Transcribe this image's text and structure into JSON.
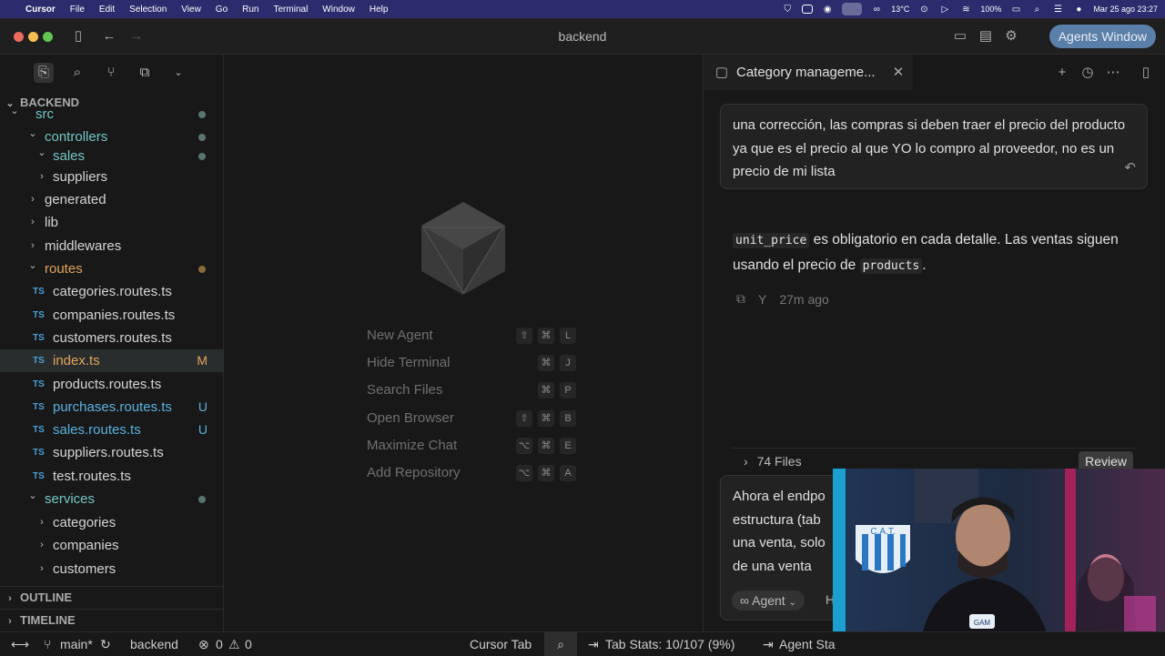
{
  "menubar": {
    "app_name": "Cursor",
    "items": [
      "File",
      "Edit",
      "Selection",
      "View",
      "Go",
      "Run",
      "Terminal",
      "Window",
      "Help"
    ],
    "temperature": "13°C",
    "battery": "100%",
    "datetime": "Mar 25 ago  23:27"
  },
  "window": {
    "title": "backend",
    "agents_button": "Agents Window"
  },
  "sidebar": {
    "explorer_title": "BACKEND",
    "tree": [
      {
        "label": "src",
        "depth": 0,
        "kind": "folder-open",
        "color": "mod",
        "dot": true
      },
      {
        "label": "controllers",
        "depth": 1,
        "kind": "folder-open",
        "color": "mod",
        "dot": true
      },
      {
        "label": "sales",
        "depth": 2,
        "kind": "folder-open",
        "color": "mod",
        "dot": true
      },
      {
        "label": "suppliers",
        "depth": 2,
        "kind": "folder",
        "color": "default"
      },
      {
        "label": "generated",
        "depth": 1,
        "kind": "folder",
        "color": "default"
      },
      {
        "label": "lib",
        "depth": 1,
        "kind": "folder",
        "color": "default"
      },
      {
        "label": "middlewares",
        "depth": 1,
        "kind": "folder",
        "color": "default"
      },
      {
        "label": "routes",
        "depth": 1,
        "kind": "folder-open",
        "color": "orange",
        "dot": true,
        "dot_color": "#8a6a3a"
      },
      {
        "label": "categories.routes.ts",
        "depth": 2,
        "kind": "ts",
        "color": "default"
      },
      {
        "label": "companies.routes.ts",
        "depth": 2,
        "kind": "ts",
        "color": "default"
      },
      {
        "label": "customers.routes.ts",
        "depth": 2,
        "kind": "ts",
        "color": "default"
      },
      {
        "label": "index.ts",
        "depth": 2,
        "kind": "ts",
        "color": "orange",
        "badge": "M",
        "selected": true
      },
      {
        "label": "products.routes.ts",
        "depth": 2,
        "kind": "ts",
        "color": "default"
      },
      {
        "label": "purchases.routes.ts",
        "depth": 2,
        "kind": "ts",
        "color": "untr",
        "badge": "U"
      },
      {
        "label": "sales.routes.ts",
        "depth": 2,
        "kind": "ts",
        "color": "untr",
        "badge": "U"
      },
      {
        "label": "suppliers.routes.ts",
        "depth": 2,
        "kind": "ts",
        "color": "default"
      },
      {
        "label": "test.routes.ts",
        "depth": 2,
        "kind": "ts",
        "color": "default"
      },
      {
        "label": "services",
        "depth": 1,
        "kind": "folder-open",
        "color": "mod",
        "dot": true
      },
      {
        "label": "categories",
        "depth": 2,
        "kind": "folder",
        "color": "default"
      },
      {
        "label": "companies",
        "depth": 2,
        "kind": "folder",
        "color": "default"
      },
      {
        "label": "customers",
        "depth": 2,
        "kind": "folder",
        "color": "default"
      }
    ],
    "outline": "OUTLINE",
    "timeline": "TIMELINE"
  },
  "editor": {
    "shortcuts": [
      {
        "label": "New Agent",
        "keys": [
          "⇧",
          "⌘",
          "L"
        ]
      },
      {
        "label": "Hide Terminal",
        "keys": [
          "⌘",
          "J"
        ]
      },
      {
        "label": "Search Files",
        "keys": [
          "⌘",
          "P"
        ]
      },
      {
        "label": "Open Browser",
        "keys": [
          "⇧",
          "⌘",
          "B"
        ]
      },
      {
        "label": "Maximize Chat",
        "keys": [
          "⌥",
          "⌘",
          "E"
        ]
      },
      {
        "label": "Add Repository",
        "keys": [
          "⌥",
          "⌘",
          "A"
        ]
      }
    ]
  },
  "chat": {
    "tab_title": "Category manageme...",
    "user_message": "una corrección, las compras si deben traer el precio del producto ya que es el precio al que YO lo compro al proveedor, no es un precio de mi lista",
    "assistant_code1": "unit_price",
    "assistant_text1": " es obligatorio en cada detalle. Las ventas siguen usando el precio de ",
    "assistant_code2": "products",
    "assistant_text2": ".",
    "time_ago": "27m ago",
    "files_label": "74 Files",
    "review_label": "Review",
    "composer_lines": [
      "Ahora el endpo",
      "estructura (tab",
      "una venta, solo",
      "de una venta"
    ],
    "agent_mode": "Agent",
    "composer_next": "H"
  },
  "statusbar": {
    "branch": "main*",
    "project": "backend",
    "errors": "0",
    "warnings": "0",
    "cursor_tab": "Cursor Tab",
    "tab_stats": "Tab Stats: 10/107 (9%)",
    "agent_status": "Agent Sta"
  },
  "webcam": {
    "crest_text": "C.A.T.",
    "mug_text": "GAM"
  }
}
